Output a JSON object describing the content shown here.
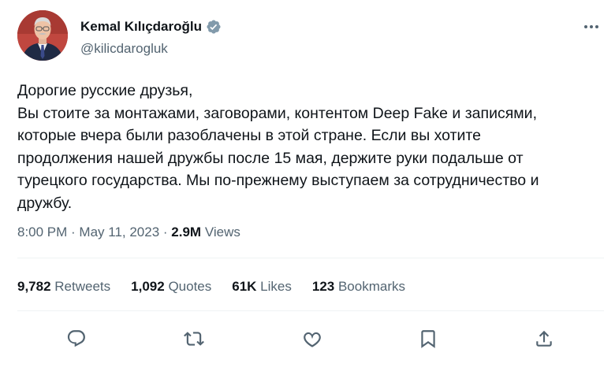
{
  "author": {
    "name": "Kemal Kılıçdaroğlu",
    "handle": "@kilicdarogluk",
    "verified": true
  },
  "tweet": {
    "lines": [
      "Дорогие русские друзья,",
      "Вы стоите за монтажами, заговорами, контентом Deep Fake и записями, которые вчера были разоблачены в этой стране. Если вы хотите продолжения нашей дружбы после 15 мая, держите руки подальше от турецкого государства. Мы по-прежнему выступаем за сотрудничество и дружбу."
    ]
  },
  "meta": {
    "time": "8:00 PM",
    "separator": " · ",
    "date": "May 11, 2023",
    "views_count": "2.9M",
    "views_label": "Views"
  },
  "stats": {
    "retweets": {
      "count": "9,782",
      "label": "Retweets"
    },
    "quotes": {
      "count": "1,092",
      "label": "Quotes"
    },
    "likes": {
      "count": "61K",
      "label": "Likes"
    },
    "bookmarks": {
      "count": "123",
      "label": "Bookmarks"
    }
  },
  "actions": [
    "reply-icon",
    "retweet-icon",
    "like-icon",
    "bookmark-icon",
    "share-icon"
  ],
  "colors": {
    "text": "#0f1419",
    "secondary": "#536471",
    "verified": "#829aab",
    "divider": "#eff3f4"
  }
}
